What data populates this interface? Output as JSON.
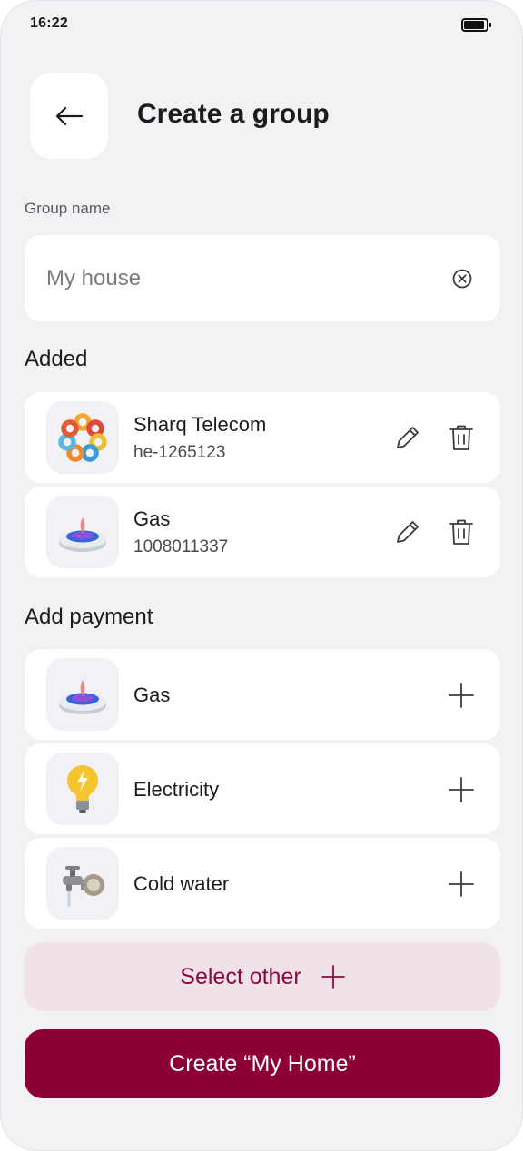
{
  "status_bar": {
    "time": "16:22"
  },
  "header": {
    "title": "Create a group",
    "back_icon": "arrow-left-icon"
  },
  "group_name": {
    "label": "Group name",
    "value": "My house",
    "clear_icon": "clear-circle-icon"
  },
  "added": {
    "title": "Added",
    "items": [
      {
        "name": "Sharq Telecom",
        "account": "he-1265123",
        "icon": "sharq-telecom-logo"
      },
      {
        "name": "Gas",
        "account": "1008011337",
        "icon": "gas-burner-icon"
      }
    ]
  },
  "add_payment": {
    "title": "Add payment",
    "items": [
      {
        "name": "Gas",
        "icon": "gas-burner-icon"
      },
      {
        "name": "Electricity",
        "icon": "light-bulb-icon"
      },
      {
        "name": "Cold water",
        "icon": "water-tap-icon"
      }
    ]
  },
  "buttons": {
    "select_other": "Select other",
    "create": "Create “My Home”"
  },
  "colors": {
    "background": "#f2f2f5",
    "accent": "#8d0034",
    "accent_light": "#f1e2ea",
    "card": "#ffffff"
  }
}
